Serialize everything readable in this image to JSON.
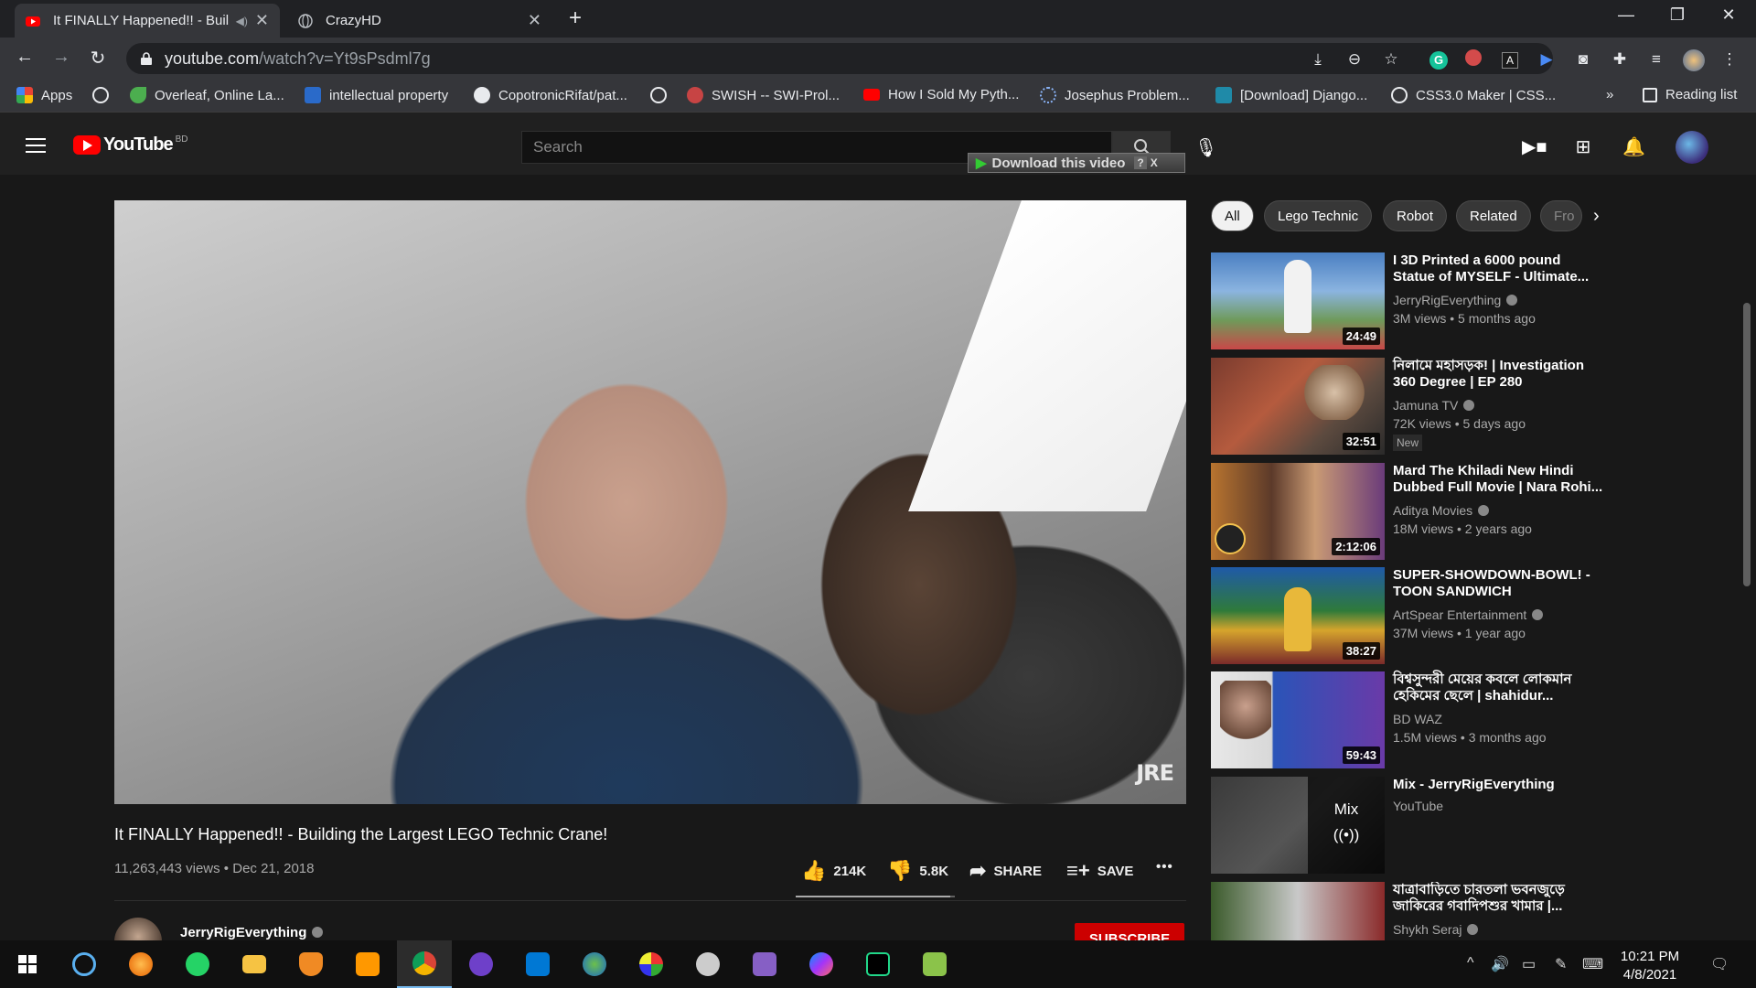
{
  "browser": {
    "tabs": [
      {
        "title": "It FINALLY Happened!! - Buil",
        "active": true,
        "icon": "youtube-icon"
      },
      {
        "title": "CrazyHD",
        "active": false,
        "icon": "globe-icon"
      }
    ],
    "url_host": "youtube.com",
    "url_path": "/watch?v=Yt9sPsdml7g",
    "bookmarks": [
      {
        "label": "Apps",
        "icon": "apps-grid-icon"
      },
      {
        "label": "",
        "icon": "globe-icon"
      },
      {
        "label": "Overleaf, Online La...",
        "icon": "overleaf-icon"
      },
      {
        "label": "intellectual property",
        "icon": "site-icon"
      },
      {
        "label": "CopotronicRifat/pat...",
        "icon": "github-icon"
      },
      {
        "label": "",
        "icon": "globe-icon"
      },
      {
        "label": "SWISH -- SWI-Prol...",
        "icon": "swish-icon"
      },
      {
        "label": "How I Sold My Pyth...",
        "icon": "youtube-icon"
      },
      {
        "label": "Josephus Problem...",
        "icon": "loading-icon"
      },
      {
        "label": "[Download] Django...",
        "icon": "site-icon"
      },
      {
        "label": "CSS3.0 Maker | CSS...",
        "icon": "globe-icon"
      }
    ],
    "bookmarks_overflow": "»",
    "reading_list": "Reading list"
  },
  "youtube": {
    "logo_text": "YouTube",
    "country_code": "BD",
    "search_placeholder": "Search",
    "download_banner": "Download this video",
    "download_banner_help": "?",
    "download_banner_close": "X"
  },
  "video": {
    "watermark": "JRE",
    "title": "It FINALLY Happened!! - Building the Largest LEGO Technic Crane!",
    "views": "11,263,443 views",
    "date": "Dec 21, 2018",
    "likes": "214K",
    "dislikes": "5.8K",
    "like_ratio": 0.974,
    "share_label": "SHARE",
    "save_label": "SAVE",
    "more_label": "•••",
    "channel": "JerryRigEverything",
    "subscribe_label": "SUBSCRIBE"
  },
  "chips": [
    "All",
    "Lego Technic",
    "Robot",
    "Related",
    "Fro"
  ],
  "recommendations": [
    {
      "title": "I 3D Printed a 6000 pound Statue of MYSELF - Ultimate...",
      "channel": "JerryRigEverything",
      "verified": true,
      "meta": "3M views • 5 months ago",
      "duration": "24:49",
      "badge": ""
    },
    {
      "title": "নিলামে মহাসড়ক! | Investigation 360 Degree | EP 280",
      "channel": "Jamuna TV",
      "verified": true,
      "meta": "72K views • 5 days ago",
      "duration": "32:51",
      "badge": "New"
    },
    {
      "title": "Mard The Khiladi New Hindi Dubbed Full Movie | Nara Rohi...",
      "channel": "Aditya Movies",
      "verified": true,
      "meta": "18M views • 2 years ago",
      "duration": "2:12:06",
      "badge": ""
    },
    {
      "title": "SUPER-SHOWDOWN-BOWL! - TOON SANDWICH",
      "channel": "ArtSpear Entertainment",
      "verified": true,
      "meta": "37M views • 1 year ago",
      "duration": "38:27",
      "badge": ""
    },
    {
      "title": "বিশ্বসুন্দরী মেয়ের কবলে লোকমান হেকিমের ছেলে | shahidur...",
      "channel": "BD WAZ",
      "verified": false,
      "meta": "1.5M views • 3 months ago",
      "duration": "59:43",
      "badge": ""
    },
    {
      "title": "Mix - JerryRigEverything",
      "channel": "YouTube",
      "verified": false,
      "meta": "",
      "duration": "",
      "badge": "",
      "mix_label": "Mix"
    },
    {
      "title": "যাত্রাবাড়িতে চারতলা ভবনজুড়ে জাকিরের গবাদিপশুর খামার |...",
      "channel": "Shykh Seraj",
      "verified": true,
      "meta": "",
      "duration": "",
      "badge": ""
    }
  ],
  "taskbar": {
    "time": "10:21 PM",
    "date": "4/8/2021"
  },
  "colors": {
    "brand_red": "#ff0000",
    "subscribe_red": "#cc0000",
    "taskbar_accent": "#76b9ed"
  }
}
